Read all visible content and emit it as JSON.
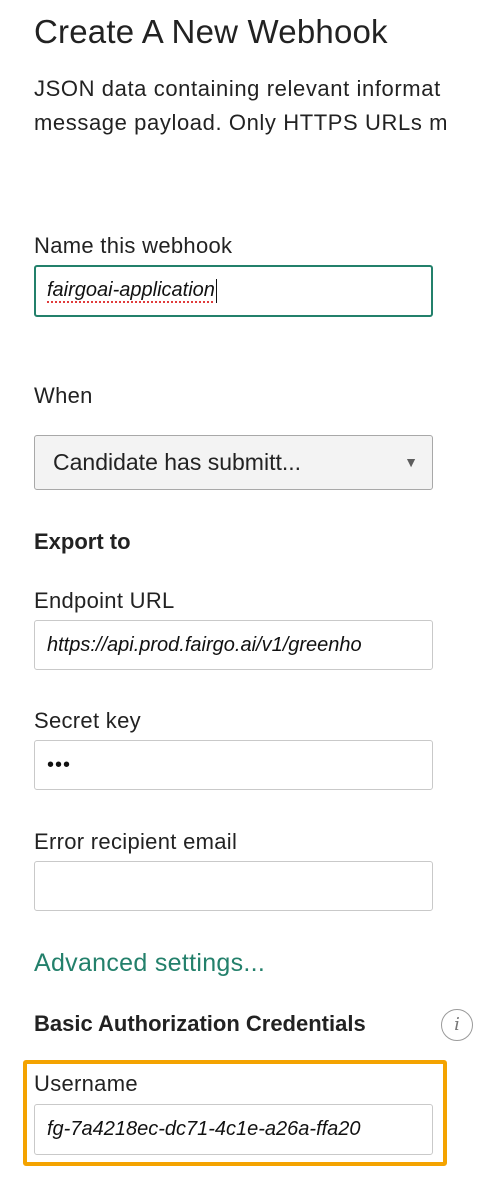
{
  "header": {
    "title": "Create A New Webhook",
    "description_line1": "JSON data containing relevant informat",
    "description_line2": "message payload. Only HTTPS URLs m"
  },
  "form": {
    "name": {
      "label": "Name this webhook",
      "value": "fairgoai-application"
    },
    "when": {
      "label": "When",
      "selected": "Candidate has submitt..."
    },
    "export_title": "Export to",
    "endpoint": {
      "label": "Endpoint URL",
      "value": "https://api.prod.fairgo.ai/v1/greenho"
    },
    "secret": {
      "label": "Secret key",
      "value": "•••"
    },
    "error_email": {
      "label": "Error recipient email",
      "value": ""
    },
    "advanced_link": "Advanced settings...",
    "auth_title": "Basic Authorization Credentials",
    "info_icon_glyph": "i",
    "username": {
      "label": "Username",
      "value": "fg-7a4218ec-dc71-4c1e-a26a-ffa20"
    }
  },
  "colors": {
    "accent_green": "#23806b",
    "highlight_orange": "#f4a300",
    "spellcheck_red": "#e03b3b"
  },
  "icons": {
    "select_arrow": "chevron-down-icon",
    "info": "info-icon"
  }
}
